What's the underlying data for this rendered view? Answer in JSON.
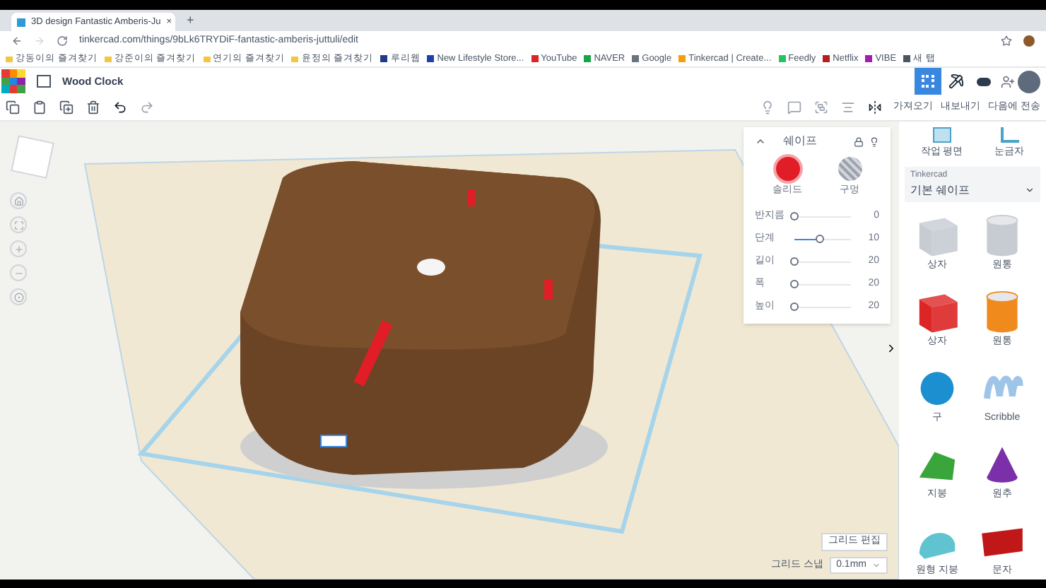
{
  "browser": {
    "tab": {
      "title": "3D design Fantastic Amberis-Ju",
      "close": "×"
    },
    "new_tab": "+",
    "url": "tinkercad.com/things/9bLk6TRYDiF-fantastic-amberis-juttuli/edit",
    "bookmarks": [
      {
        "label": "강동이의 즐겨찾기",
        "kind": "folder"
      },
      {
        "label": "강준이의 즐겨찾기",
        "kind": "folder"
      },
      {
        "label": "연기의 즐겨찾기",
        "kind": "folder"
      },
      {
        "label": "윤정의 즐겨찾기",
        "kind": "folder"
      },
      {
        "label": "루리웹",
        "kind": "site",
        "color": "#1e3a8a"
      },
      {
        "label": "New Lifestyle Store...",
        "kind": "site",
        "color": "#1e40af"
      },
      {
        "label": "YouTube",
        "kind": "site",
        "color": "#dc2626"
      },
      {
        "label": "NAVER",
        "kind": "site",
        "color": "#16a34a"
      },
      {
        "label": "Google",
        "kind": "site",
        "color": "#6b7280"
      },
      {
        "label": "Tinkercad | Create...",
        "kind": "site",
        "color": "#f59e0b"
      },
      {
        "label": "Feedly",
        "kind": "site",
        "color": "#22c55e"
      },
      {
        "label": "Netflix",
        "kind": "site",
        "color": "#b91c1c"
      },
      {
        "label": "VIBE",
        "kind": "site",
        "color": "#a21caf"
      },
      {
        "label": "새 탭",
        "kind": "site",
        "color": "#4b5563"
      }
    ]
  },
  "app": {
    "title": "Wood Clock",
    "actions": [
      "가져오기",
      "내보내기",
      "다음에 전송"
    ]
  },
  "inspector": {
    "title": "쉐이프",
    "modes": [
      {
        "label": "솔리드",
        "kind": "solid",
        "selected": true
      },
      {
        "label": "구멍",
        "kind": "hole",
        "selected": false
      }
    ],
    "params": [
      {
        "label": "반지름",
        "level": 0,
        "reading": "0"
      },
      {
        "label": "단계",
        "level": 0.45,
        "reading": "10"
      },
      {
        "label": "길이",
        "level": 0,
        "reading": "20"
      },
      {
        "label": "폭",
        "level": 0,
        "reading": "20"
      },
      {
        "label": "높이",
        "level": 0,
        "reading": "20"
      }
    ]
  },
  "library": {
    "tools": [
      "작업 평면",
      "눈금자"
    ],
    "source": "Tinkercad",
    "category": "기본 쉐이프",
    "shapes": [
      {
        "label": "상자",
        "kind": "box",
        "color": "#c7ccd3"
      },
      {
        "label": "원통",
        "kind": "cylinder",
        "color": "#c7ccd3"
      },
      {
        "label": "상자",
        "kind": "box",
        "color": "#dc2626"
      },
      {
        "label": "원통",
        "kind": "cylinder",
        "color": "#f08a1c"
      },
      {
        "label": "구",
        "kind": "sphere",
        "color": "#1b8fd0"
      },
      {
        "label": "Scribble",
        "kind": "scribble",
        "color": "#9ec5e8"
      },
      {
        "label": "지붕",
        "kind": "roof",
        "color": "#3aa53a"
      },
      {
        "label": "원추",
        "kind": "cone",
        "color": "#7b2fa8"
      },
      {
        "label": "원형 지붕",
        "kind": "round_roof",
        "color": "#5fc4cf"
      },
      {
        "label": "문자",
        "kind": "text",
        "color": "#c01818"
      }
    ]
  },
  "grid": {
    "edit": "그리드 편집",
    "snap_label": "그리드 스냅",
    "snap_value": "0.1mm"
  }
}
